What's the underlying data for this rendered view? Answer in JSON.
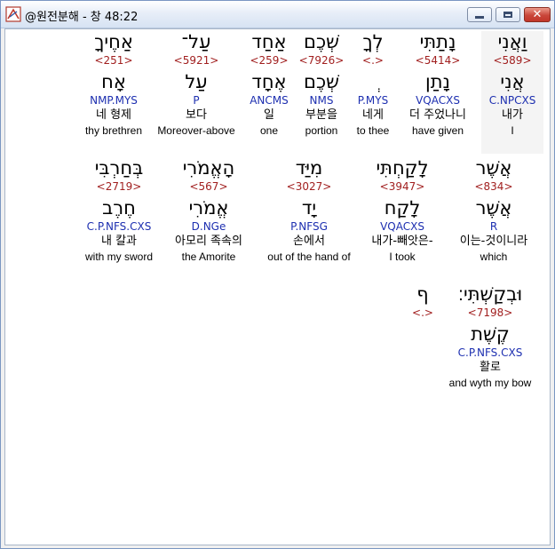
{
  "window": {
    "title": "@원전분해 - 창 48:22",
    "icon": "bible-book-icon",
    "controls": {
      "minimize": "minimize-icon",
      "maximize": "maximize-icon",
      "close": "close-icon"
    }
  },
  "rows": [
    [
      {
        "hebrew": "וַאֲנִי",
        "strong": "<589>",
        "lemma": "אֲנִי",
        "parse": "C.NPCXS",
        "korean": "내가",
        "english": "I",
        "highlight": true
      },
      {
        "hebrew": "נָתַתִּי",
        "strong": "<5414>",
        "lemma": "נָתַן",
        "parse": "VQACXS",
        "korean": "더 주었나니",
        "english": "have given"
      },
      {
        "hebrew": "לְךָ",
        "strong": "<.>",
        "lemma": "ְ",
        "parse": "P.MYS",
        "korean": "네게",
        "english": "to thee"
      },
      {
        "hebrew": "שְׁכֶם",
        "strong": "<7926>",
        "lemma": "שְׁכֶם",
        "parse": "NMS",
        "korean": "부분을",
        "english": "portion"
      },
      {
        "hebrew": "אַחַד",
        "strong": "<259>",
        "lemma": "אֶחָד",
        "parse": "ANCMS",
        "korean": "일",
        "english": "one"
      },
      {
        "hebrew": "עַל־",
        "strong": "<5921>",
        "lemma": "עַל",
        "parse": "P",
        "korean": "보다",
        "english": "Moreover-above"
      },
      {
        "hebrew": "אַחֶיךָ",
        "strong": "<251>",
        "lemma": "אָח",
        "parse": "NMP.MYS",
        "korean": "네 형제",
        "english": "thy brethren"
      }
    ],
    [
      {
        "hebrew": "אֲשֶׁר",
        "strong": "<834>",
        "lemma": "אֲשֶׁר",
        "parse": "R",
        "korean": "이는-것이니라",
        "english": "which"
      },
      {
        "hebrew": "לָקַחְתִּי",
        "strong": "<3947>",
        "lemma": "לָקַח",
        "parse": "VQACXS",
        "korean": "내가-빼앗은-",
        "english": "I took"
      },
      {
        "hebrew": "מִיַּד",
        "strong": "<3027>",
        "lemma": "יָד",
        "parse": "P.NFSG",
        "korean": "손에서",
        "english": "out of the hand of"
      },
      {
        "hebrew": "הָאֱמֹרִי",
        "strong": "<567>",
        "lemma": "אֱמֹרִי",
        "parse": "D.NGe",
        "korean": "아모리 족속의",
        "english": "the Amorite"
      },
      {
        "hebrew": "בְּחַרְבִּי",
        "strong": "<2719>",
        "lemma": "חֶרֶב",
        "parse": "C.P.NFS.CXS",
        "korean": "내 칼과",
        "english": "with my sword"
      }
    ],
    [
      {
        "hebrew": "וּבְקַשְׁתִּי׃",
        "strong": "<7198>",
        "lemma": "קֶשֶׁת",
        "parse": "C.P.NFS.CXS",
        "korean": "활로",
        "english": "and wyth my bow"
      },
      {
        "hebrew": "ף",
        "strong": "<.>",
        "lemma": "",
        "parse": "",
        "korean": "",
        "english": ""
      }
    ]
  ]
}
